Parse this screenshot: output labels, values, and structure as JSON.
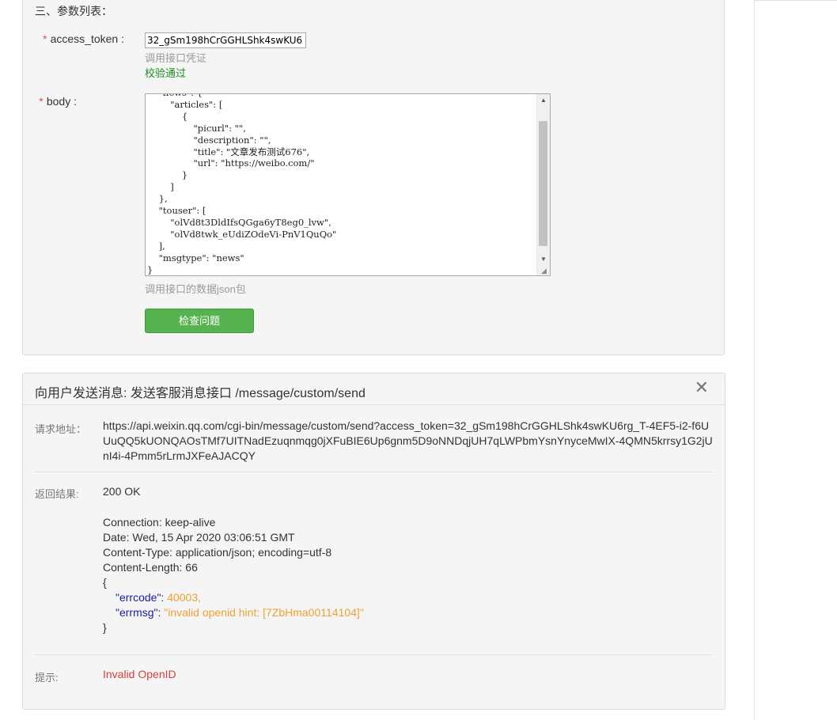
{
  "params": {
    "section_title": "三、参数列表：",
    "access_token": {
      "label": "access_token :",
      "value": "32_gSm198hCrGGHLShk4swKU6",
      "hint": "调用接口凭证",
      "status": "校验通过"
    },
    "body": {
      "label": "body :",
      "code": "    \"news\": {\n        \"articles\": [\n            {\n                \"picurl\": \"\",\n                \"description\": \"\",\n                \"title\": \"文章发布测试676\",\n                \"url\": \"https://weibo.com/\"\n            }\n        ]\n    },\n    \"touser\": [\n        \"olVd8t3DldIfsQGga6yT8eg0_lvw\",\n        \"olVd8twk_eUdiZOdeVi-PnV1QuQo\"\n    ],\n    \"msgtype\": \"news\"\n}",
      "hint": "调用接口的数据json包"
    },
    "check_button": "检查问题",
    "required_mark": "*"
  },
  "result": {
    "title": "向用户发送消息: 发送客服消息接口 /message/custom/send",
    "close_glyph": "✕",
    "request_label": "请求地址：",
    "request_url": "https://api.weixin.qq.com/cgi-bin/message/custom/send?access_token=32_gSm198hCrGGHLShk4swKU6rg_T-4EF5-i2-f6UUuQQ5kUONQAOsTMf7UITNadEzuqnmqg0jXFuBIE6Up6gnm5D9oNNDqjUH7qLWPbmYsnYnyceMwIX-4QMN5krrsy1G2jUnI4i-4Pmm5rLrmJXFeAJACQY",
    "return_label": "返回结果:",
    "status_line": "200 OK",
    "headers": [
      "Connection: keep-alive",
      "Date: Wed, 15 Apr 2020 03:06:51 GMT",
      "Content-Type: application/json; encoding=utf-8",
      "Content-Length: 66"
    ],
    "json": {
      "open": "{",
      "close": "}",
      "errcode_key": "\"errcode\"",
      "errcode_val": "40003,",
      "errmsg_key": "\"errmsg\"",
      "errmsg_val": "\"invalid openid hint: [7ZbHma00114104]\"",
      "colon": ": "
    },
    "tip_label": "提示:",
    "tip_text": "Invalid OpenID"
  },
  "colors": {
    "accent_green": "#57b350",
    "success_text": "#1e8c1e",
    "error_text": "#d43f3a",
    "required_mark": "#d9534f",
    "json_key": "#1a1aa6",
    "json_value": "#f0a030"
  },
  "icons": {
    "scroll_up": "up-arrow-icon",
    "scroll_down": "down-arrow-icon",
    "resize": "resize-grip-icon",
    "close": "close-icon"
  }
}
